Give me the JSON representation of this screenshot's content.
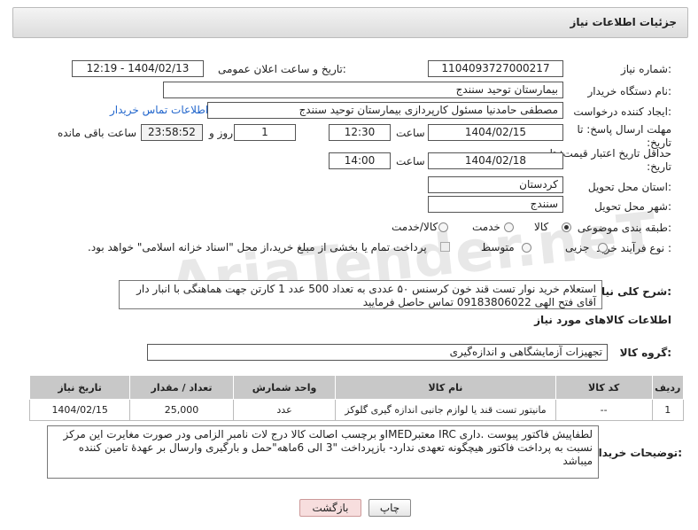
{
  "header": {
    "title": "جزئیات اطلاعات نیاز"
  },
  "fields": {
    "need_number_label": "شماره نیاز:",
    "need_number": "1104093727000217",
    "announce_label": "تاریخ و ساعت اعلان عمومی:",
    "announce_value": "1404/02/13 - 12:19",
    "buyer_org_label": "نام دستگاه خریدار:",
    "buyer_org": "بیمارستان توحید سنندج",
    "creator_label": "ایجاد کننده درخواست:",
    "creator": "مصطفی حامدنیا مسئول کارپردازی بیمارستان توحید سنندج",
    "buyer_contact_link": "اطلاعات تماس خریدار",
    "reply_deadline_label": "مهلت ارسال پاسخ: تا تاریخ:",
    "reply_date": "1404/02/15",
    "time_label": "ساعت",
    "reply_time": "12:30",
    "days_value": "1",
    "days_label": "روز و",
    "remaining_value": "23:58:52",
    "remaining_label": "ساعت باقی مانده",
    "price_deadline_label": "حداقل تاریخ اعتبار قیمت: تا تاریخ:",
    "price_date": "1404/02/18",
    "price_time": "14:00",
    "province_label": "استان محل تحویل:",
    "province": "کردستان",
    "city_label": "شهر محل تحویل:",
    "city": "سنندج",
    "category_label": "طبقه بندی موضوعی:",
    "category_options": [
      "کالا",
      "خدمت",
      "کالا/خدمت"
    ],
    "process_label": "نوع فرآیند خرید :",
    "process_options": [
      "جزیی",
      "متوسط"
    ],
    "payment_note": "پرداخت تمام یا بخشی از مبلغ خرید،از محل \"اسناد خزانه اسلامی\" خواهد بود."
  },
  "description": {
    "label": "شرح کلی نیاز:",
    "text": "استعلام خرید نوار تست قند خون کرسنس ۵۰ عددی به تعداد 500 عدد 1 کارتن جهت هماهنگی با انبار دار آقای فتح الهی 09183806022 تماس حاصل فرمایید"
  },
  "goods": {
    "section_title": "اطلاعات کالاهای مورد نیاز",
    "group_label": "گروه کالا:",
    "group_value": "تجهیزات آزمایشگاهی و اندازه‌گیری",
    "columns": [
      "ردیف",
      "کد کالا",
      "نام کالا",
      "واحد شمارش",
      "تعداد / مقدار",
      "تاریخ نیاز"
    ],
    "rows": [
      [
        "1",
        "--",
        "مانیتور تست قند یا لوازم جانبی اندازه گیری گلوکز",
        "عدد",
        "25,000",
        "1404/02/15"
      ]
    ]
  },
  "buyer_notes": {
    "label": "توضیحات خریدار:",
    "text": "لطفاپیش فاکتور پیوست .داری IRC معتبرIMEDو برچسب اصالت کالا درج لات نامبر الزامی ودر صورت مغایرت این مرکز نسبت به پرداخت فاکتور هیچگونه تعهدی ندارد- بازپرداخت \"3 الی 6ماهه\"حمل و بارگیری وارسال بر عهدهٔ تامین کننده میباشد"
  },
  "buttons": {
    "print": "چاپ",
    "back": "بازگشت"
  },
  "watermark": "AriaTender.neT"
}
